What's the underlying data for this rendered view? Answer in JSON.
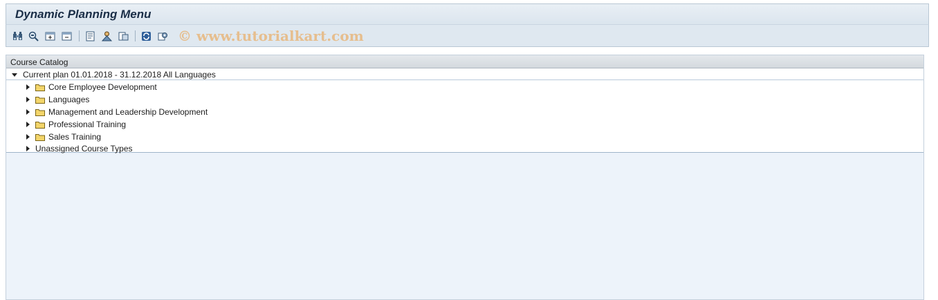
{
  "window": {
    "title": "Dynamic Planning Menu"
  },
  "toolbar": {
    "buttons": [
      {
        "icon": "binoculars-icon"
      },
      {
        "icon": "find-next-icon"
      },
      {
        "icon": "expand-all-icon"
      },
      {
        "icon": "collapse-all-icon"
      },
      {
        "icon": "details-icon"
      },
      {
        "icon": "user-mountain-icon"
      },
      {
        "icon": "display-object-icon"
      },
      {
        "icon": "refresh-icon"
      },
      {
        "icon": "settings-icon"
      }
    ],
    "watermark": "© www.tutorialkart.com"
  },
  "panel": {
    "header": "Course Catalog",
    "root": {
      "label": "Current plan 01.01.2018 - 31.12.2018 All Languages"
    },
    "items": [
      {
        "label": "Core Employee Development",
        "folder": true
      },
      {
        "label": "Languages",
        "folder": true
      },
      {
        "label": "Management and Leadership Development",
        "folder": true
      },
      {
        "label": "Professional Training",
        "folder": true
      },
      {
        "label": "Sales Training",
        "folder": true
      },
      {
        "label": "Unassigned Course Types",
        "folder": false
      }
    ]
  },
  "colors": {
    "title_text": "#1a2e47",
    "panel_bg": "#edf3fa",
    "folder_yellow": "#f3d56a",
    "watermark": "#e8b06e"
  }
}
